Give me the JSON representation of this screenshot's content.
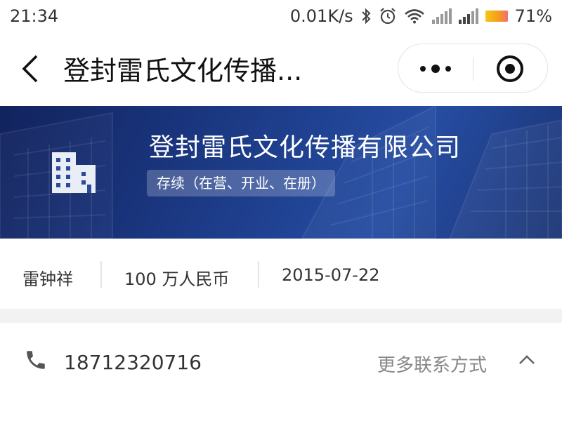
{
  "status_bar": {
    "time": "21:34",
    "net_speed": "0.01K/s",
    "battery_percent": "71%",
    "icons": [
      "bluetooth-icon",
      "alarm-icon",
      "wifi-icon",
      "signal-icon",
      "signal-icon",
      "battery-icon"
    ]
  },
  "nav": {
    "title": "登封雷氏文化传播...",
    "icons": [
      "back-arrow-icon",
      "more-dots-icon",
      "close-target-icon"
    ]
  },
  "company": {
    "name": "登封雷氏文化传播有限公司",
    "status": "存续（在营、开业、在册）",
    "icon": "building-icon"
  },
  "info": {
    "legal_person": "雷钟祥",
    "registered_capital": "100 万人民币",
    "established_date": "2015-07-22"
  },
  "contact": {
    "phone": "18712320716",
    "more_label": "更多联系方式",
    "icons": [
      "phone-icon",
      "chevron-up-icon"
    ]
  },
  "colors": {
    "banner_primary": "#1c3a86",
    "text_primary": "#333333",
    "text_secondary": "#888888"
  }
}
